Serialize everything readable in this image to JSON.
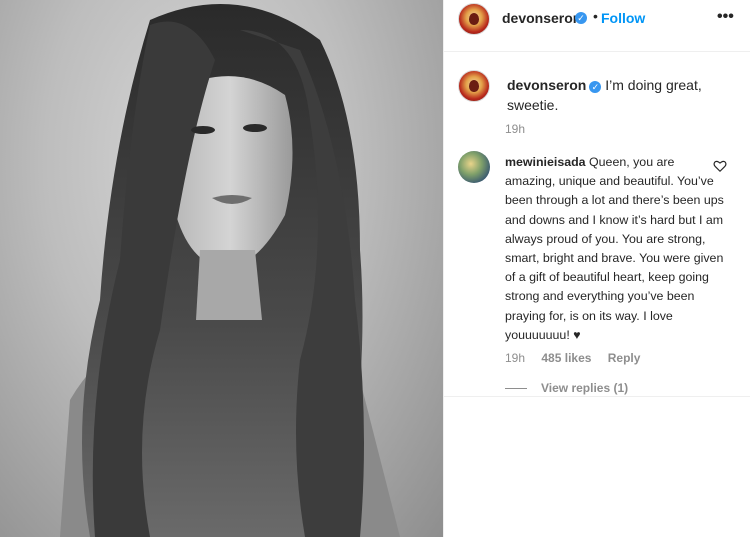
{
  "header": {
    "username": "devonseron",
    "follow_label": "Follow",
    "dot": "•",
    "more_label": "•••",
    "verified_icon": "verified-badge-icon"
  },
  "caption": {
    "username": "devonseron",
    "text": " I’m doing great, sweetie.",
    "time": "19h"
  },
  "comment": {
    "username": "mewinieisada",
    "text": " Queen, you are amazing, unique and beautiful. You’ve been through a lot and there’s been ups and downs and I know it’s hard but I am always proud of you. You are strong, smart, bright and brave. You were given of a gift of beautiful heart, keep going strong and everything you’ve been praying for, is on its way. I love youuuuuuu! ♥",
    "time": "19h",
    "likes": "485 likes",
    "reply_label": "Reply",
    "view_replies": "View replies (1)",
    "like_icon": "heart-outline-icon"
  },
  "colors": {
    "accent": "#0095f6",
    "verified": "#3897f0",
    "muted": "#8e8e8e",
    "text": "#262626"
  }
}
